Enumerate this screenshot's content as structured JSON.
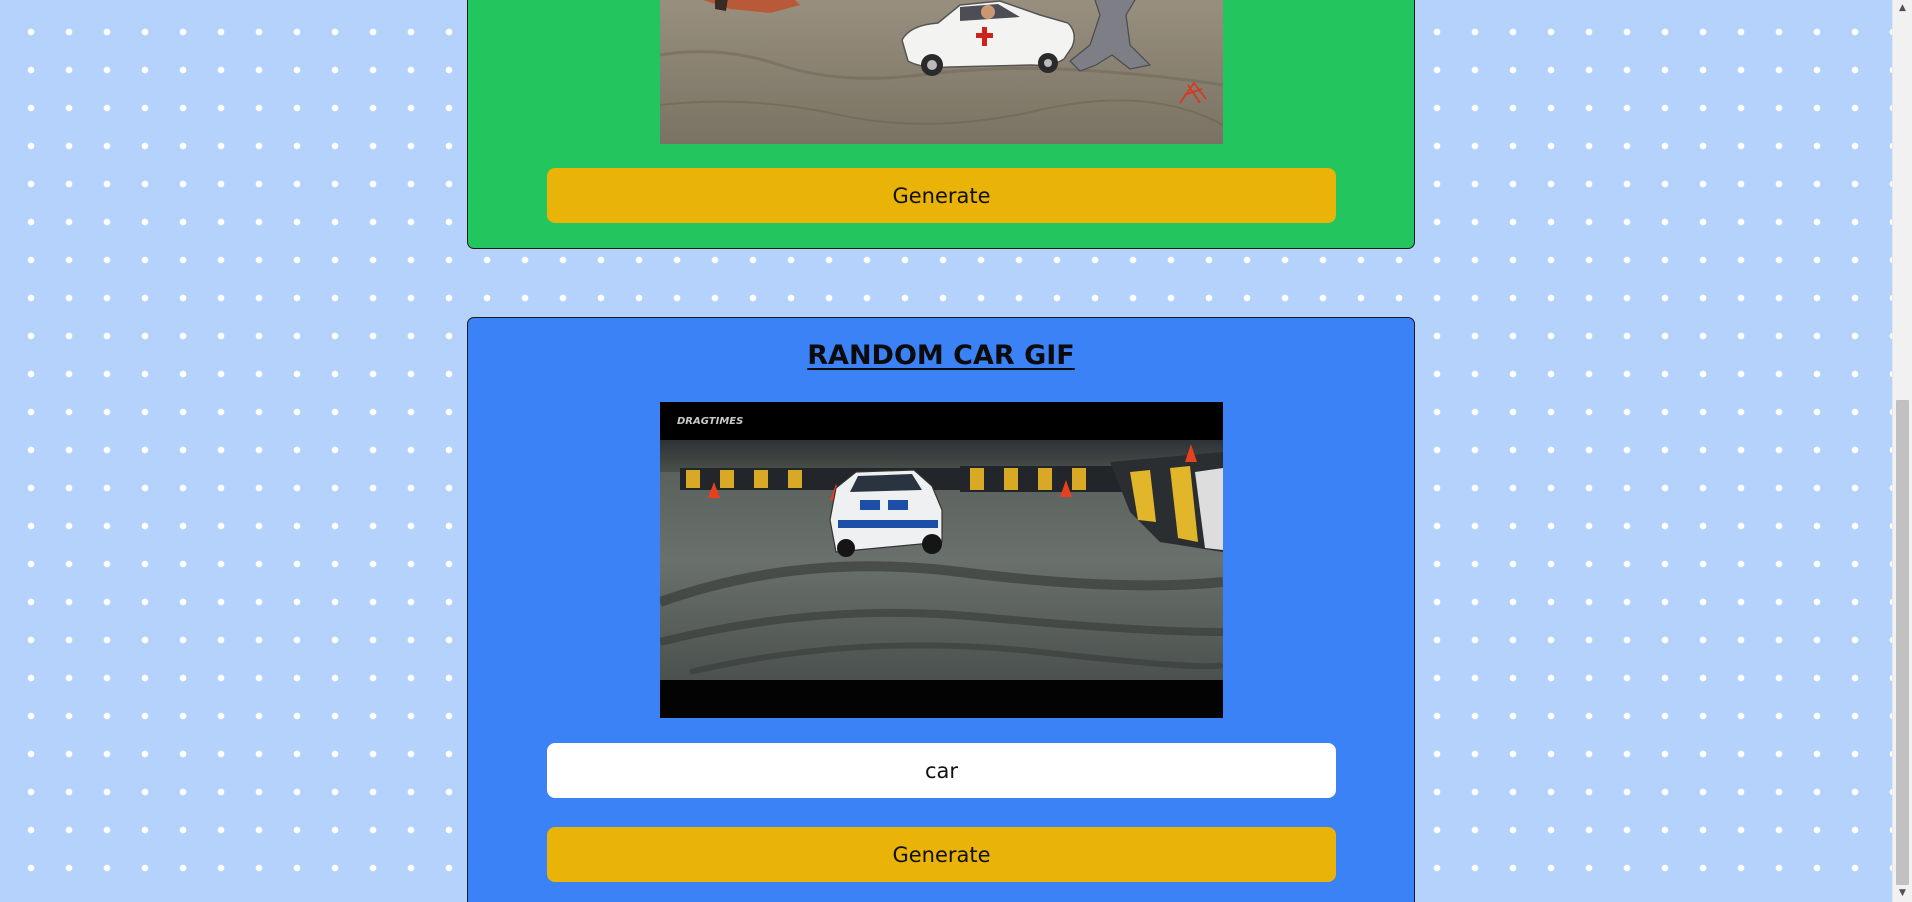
{
  "top_card": {
    "generate_label": "Generate"
  },
  "car_card": {
    "title": "RANDOM CAR GIF",
    "search_value": "car",
    "generate_label": "Generate",
    "gif_watermark": "DRAGTIMES"
  },
  "colors": {
    "page_background": "#b4d2fb",
    "top_card_background": "#22c55e",
    "car_card_background": "#3b82f6",
    "button_background": "#eab308",
    "input_background": "#ffffff"
  },
  "icons": {
    "scroll_up": "scroll-up-arrow-icon",
    "scroll_down": "scroll-down-arrow-icon"
  }
}
